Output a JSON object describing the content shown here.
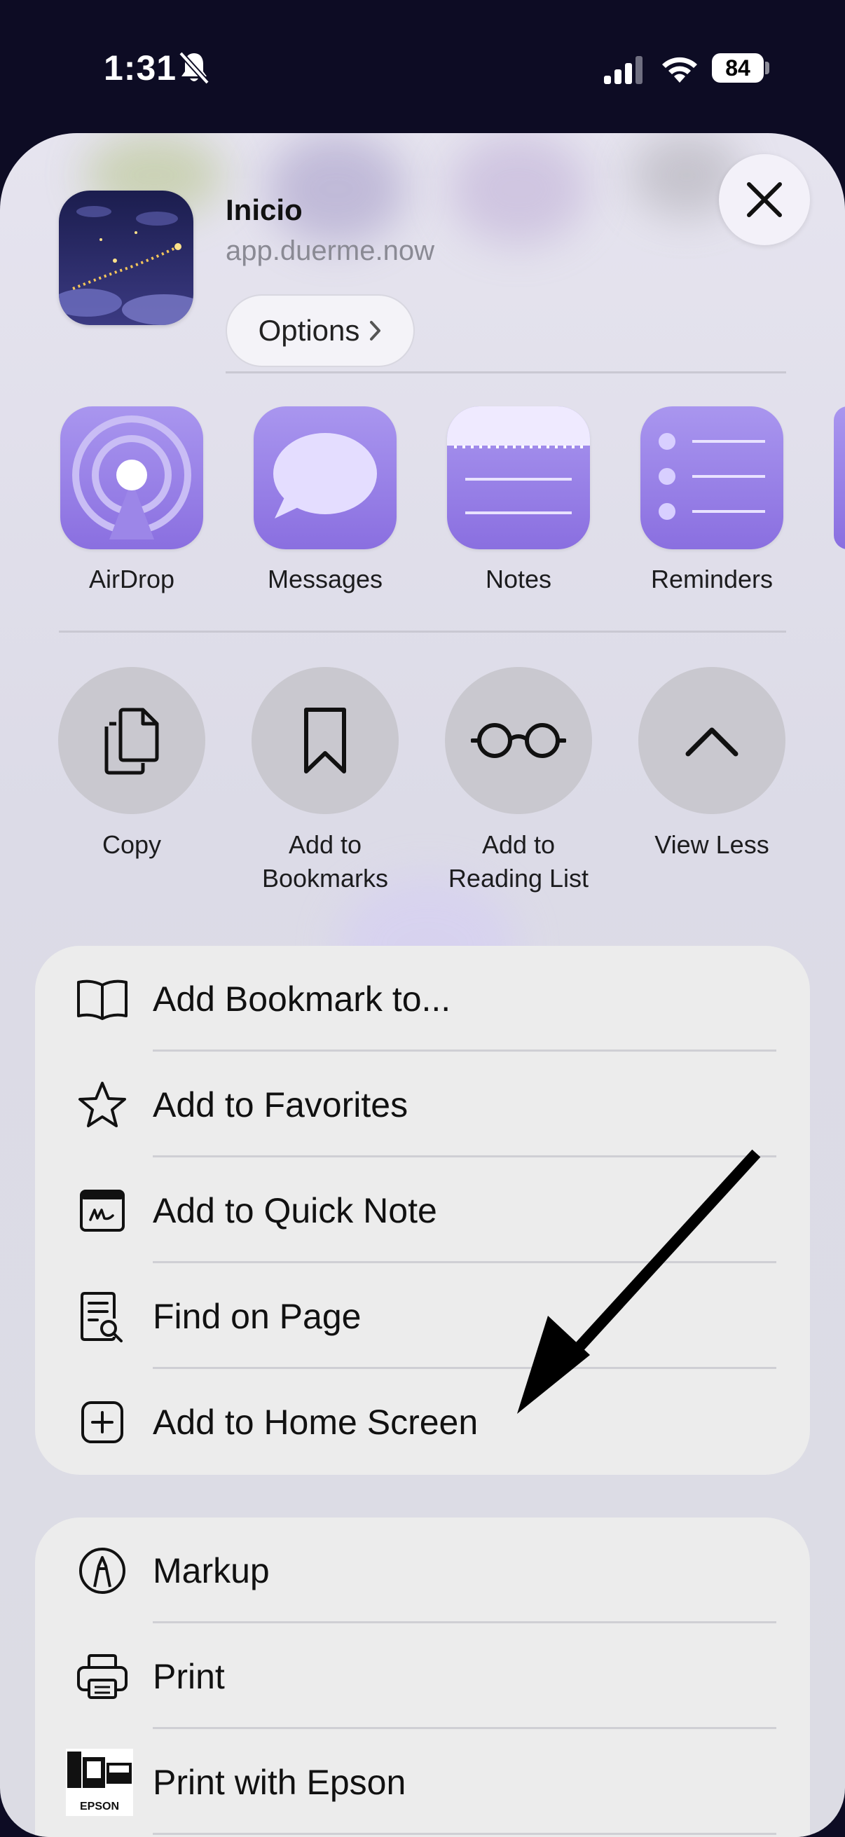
{
  "status_bar": {
    "time": "1:31",
    "battery": "84"
  },
  "header": {
    "title": "Inicio",
    "url": "app.duerme.now",
    "options_label": "Options"
  },
  "apps": [
    {
      "label": "AirDrop",
      "icon": "airdrop-icon"
    },
    {
      "label": "Messages",
      "icon": "messages-icon"
    },
    {
      "label": "Notes",
      "icon": "notes-icon"
    },
    {
      "label": "Reminders",
      "icon": "reminders-icon"
    }
  ],
  "actions": [
    {
      "label": "Copy",
      "icon": "copy-icon"
    },
    {
      "label": "Add to\nBookmarks",
      "icon": "bookmark-icon"
    },
    {
      "label": "Add to\nReading List",
      "icon": "glasses-icon"
    },
    {
      "label": "View Less",
      "icon": "chevron-up-icon"
    }
  ],
  "menu_group_1": [
    {
      "label": "Add Bookmark to...",
      "icon": "book-icon"
    },
    {
      "label": "Add to Favorites",
      "icon": "star-icon"
    },
    {
      "label": "Add to Quick Note",
      "icon": "quick-note-icon"
    },
    {
      "label": "Find on Page",
      "icon": "find-on-page-icon"
    },
    {
      "label": "Add to Home Screen",
      "icon": "add-square-icon"
    }
  ],
  "menu_group_2": [
    {
      "label": "Markup",
      "icon": "markup-icon"
    },
    {
      "label": "Print",
      "icon": "printer-icon"
    },
    {
      "label": "Print with Epson",
      "icon": "epson-icon",
      "icon_text": "EPSON"
    }
  ],
  "colors": {
    "app_tile": "#8a6fe0",
    "sheet_bg": "#e3e2ec",
    "background": "#0d0c24"
  }
}
